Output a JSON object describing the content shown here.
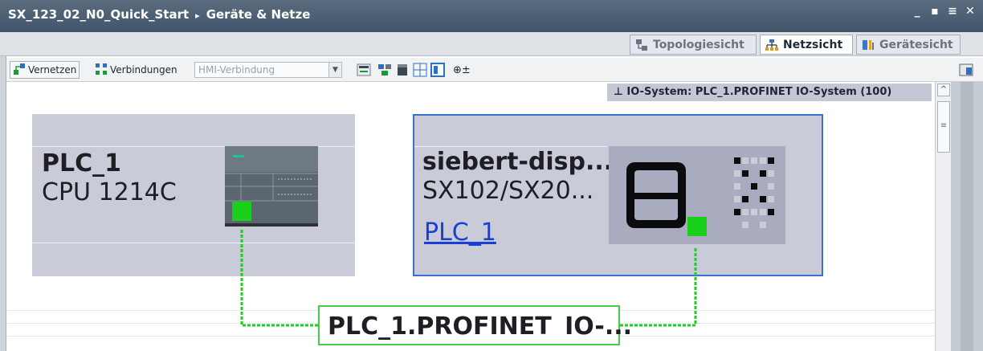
{
  "window": {
    "project": "SX_123_02_N0_Quick_Start",
    "separator": "▸",
    "section": "Geräte & Netze",
    "controls": [
      "_",
      "▪",
      "≡",
      "✕"
    ]
  },
  "tabs": [
    {
      "label": "Topologiesicht",
      "icon": "topology-icon",
      "active": false
    },
    {
      "label": "Netzsicht",
      "icon": "network-icon",
      "active": true
    },
    {
      "label": "Gerätesicht",
      "icon": "device-icon",
      "active": false
    }
  ],
  "toolbar": {
    "connect_label": "Vernetzen",
    "connections_label": "Verbindungen",
    "connection_type_value": "HMI-Verbindung",
    "zoom_glyph": "⊕±"
  },
  "infobar": {
    "pin_glyph": "⊥",
    "text": "IO-System: PLC_1.PROFINET IO-System (100)"
  },
  "devices": [
    {
      "name": "PLC_1",
      "type": "CPU 1214C"
    },
    {
      "name": "siebert-disp...",
      "type": "SX102/SX20...",
      "assigned_controller": "PLC_1"
    }
  ],
  "network": {
    "label": "PLC_1.PROFINET IO-...",
    "line_color": "#19d01b"
  },
  "scrollbar": {
    "up": "^",
    "thumb": "≡"
  },
  "colors": {
    "title_bar": "#4c5e72",
    "device_box": "#c9ccd8",
    "port": "#19d01b",
    "link": "#1a3fd6",
    "infobar": "#c3c8d4"
  }
}
